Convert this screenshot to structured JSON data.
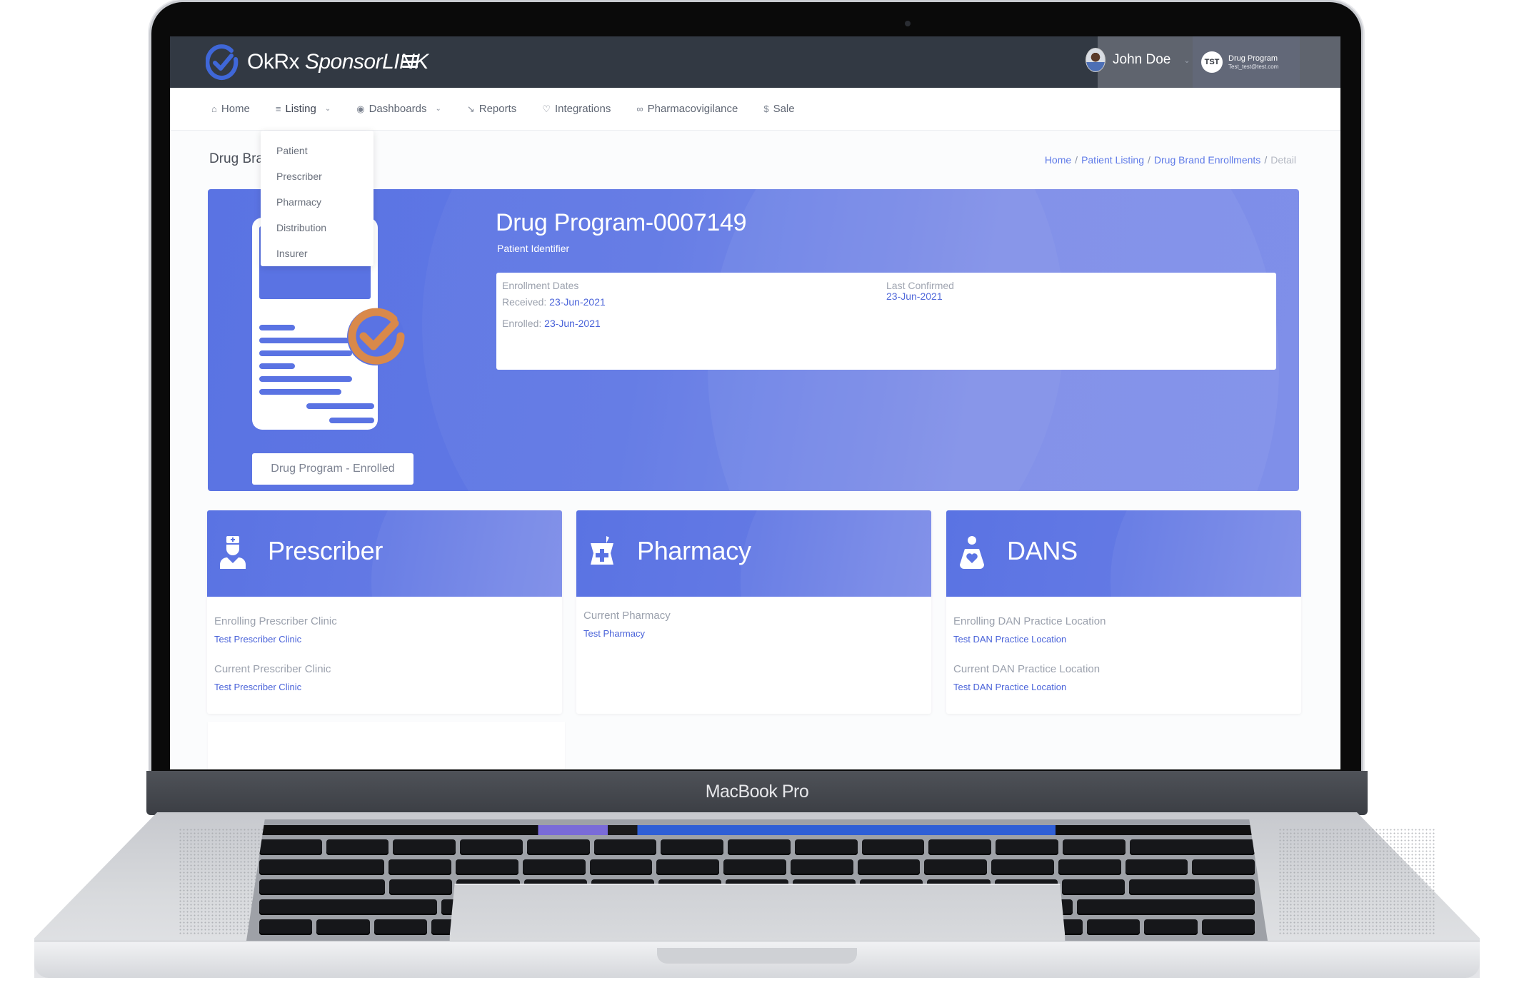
{
  "device": {
    "label": "MacBook Pro"
  },
  "app": {
    "brand_ok": "OkRx",
    "brand_sponsor": "SponsorLINK",
    "user_name": "John Doe",
    "org": {
      "badge": "TST",
      "name": "Drug Program",
      "email": "Test_test@test.com"
    }
  },
  "nav": {
    "items": [
      {
        "label": "Home",
        "icon": "home-icon"
      },
      {
        "label": "Listing",
        "icon": "list-icon",
        "has_caret": true
      },
      {
        "label": "Dashboards",
        "icon": "dashboard-icon",
        "has_caret": true
      },
      {
        "label": "Reports",
        "icon": "chart-icon"
      },
      {
        "label": "Integrations",
        "icon": "shield-icon"
      },
      {
        "label": "Pharmacovigilance",
        "icon": "link-icon"
      },
      {
        "label": "Sale",
        "icon": "dollar-icon"
      }
    ],
    "listing_menu": [
      "Patient",
      "Prescriber",
      "Pharmacy",
      "Distribution",
      "Insurer"
    ]
  },
  "page": {
    "title": "Drug Brand Enrollments",
    "breadcrumb": [
      "Home",
      "Patient Listing",
      "Drug Brand Enrollments",
      "Detail"
    ]
  },
  "hero": {
    "title": "Drug Program-0007149",
    "subtitle": "Patient Identifier",
    "status_button": "Drug Program - Enrolled",
    "enrollment_dates_label": "Enrollment Dates",
    "received_label": "Received:",
    "received_value": "23-Jun-2021",
    "enrolled_label": "Enrolled:",
    "enrolled_value": "23-Jun-2021",
    "last_confirmed_label": "Last Confirmed",
    "last_confirmed_value": "23-Jun-2021"
  },
  "cards": [
    {
      "title": "Prescriber",
      "icon": "doctor-icon",
      "fields": [
        {
          "label": "Enrolling Prescriber Clinic",
          "value": "Test Prescriber Clinic"
        },
        {
          "label": "Current Prescriber Clinic",
          "value": "Test Prescriber Clinic"
        }
      ]
    },
    {
      "title": "Pharmacy",
      "icon": "mortar-pestle-icon",
      "fields": [
        {
          "label": "Current Pharmacy",
          "value": "Test Pharmacy"
        }
      ]
    },
    {
      "title": "DANS",
      "icon": "person-heart-icon",
      "fields": [
        {
          "label": "Enrolling DAN Practice Location",
          "value": "Test DAN Practice Location"
        },
        {
          "label": "Current DAN Practice Location",
          "value": "Test DAN Practice Location"
        }
      ]
    }
  ],
  "colors": {
    "accent": "#5a73e3",
    "link": "#4a63d9",
    "header_bg": "#323943",
    "check_orange": "#d9894a"
  }
}
